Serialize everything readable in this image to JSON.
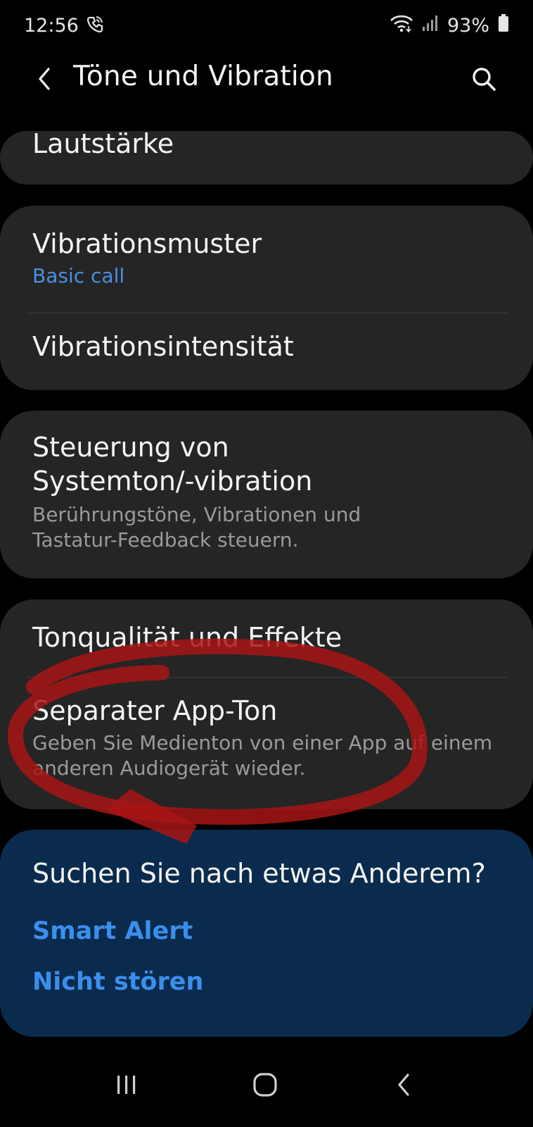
{
  "status_bar": {
    "time": "12:56",
    "battery": "93%",
    "icons": [
      "wifi-call-icon",
      "wifi-icon",
      "signal-icon",
      "battery-icon"
    ]
  },
  "app_bar": {
    "title": "Töne und Vibration",
    "back_icon": "back-arrow-icon",
    "search_icon": "search-icon"
  },
  "settings": {
    "volume": {
      "title": "Lautstärke"
    },
    "vibration_pattern": {
      "title": "Vibrationsmuster",
      "value": "Basic call"
    },
    "vibration_intensity": {
      "title": "Vibrationsintensität"
    },
    "system_sound": {
      "title_line1": "Steuerung von",
      "title_line2": "Systemton/-vibration",
      "sub_line1": "Berührungstöne, Vibrationen und",
      "sub_line2": "Tastatur-Feedback steuern."
    },
    "sound_quality": {
      "title": "Tonqualität und Effekte"
    },
    "separate_app_sound": {
      "title": "Separater App-Ton",
      "sub_line1": "Geben Sie Medienton von einer App auf einem",
      "sub_line2": "anderen Audiogerät wieder."
    }
  },
  "suggestions": {
    "title": "Suchen Sie nach etwas Anderem?",
    "links": [
      "Smart Alert",
      "Nicht stören"
    ]
  },
  "nav_bar": {
    "icons": [
      "recent-apps-icon",
      "home-icon",
      "back-icon"
    ]
  },
  "colors": {
    "background": "#000000",
    "card": "#252525",
    "accent_blue": "#4a90e2",
    "suggest_bg": "#0a2b4d",
    "annotation_red": "#b01818"
  }
}
